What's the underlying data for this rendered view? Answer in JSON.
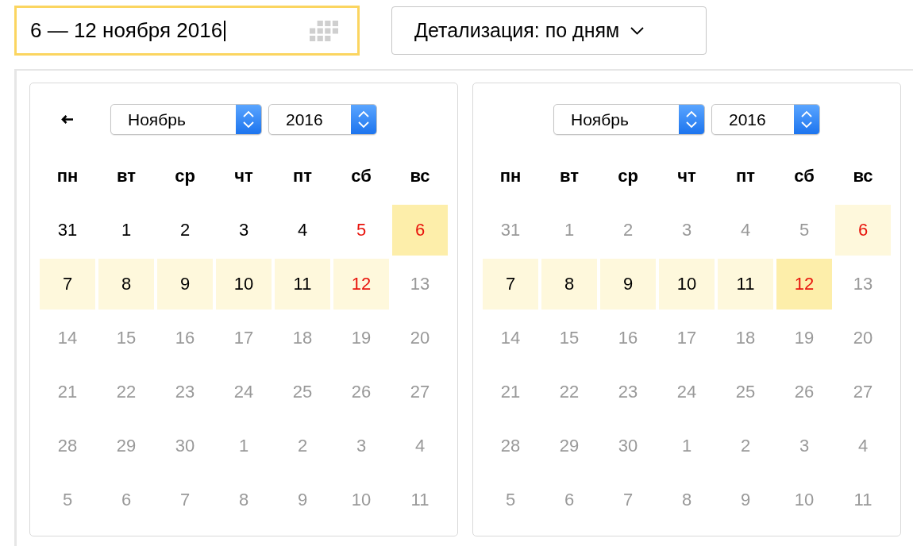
{
  "date_field": {
    "value": "6 — 12 ноября 2016",
    "focused": true
  },
  "detail_dropdown": {
    "label": "Детализация: по дням"
  },
  "calendars": [
    {
      "back_arrow": true,
      "month_select": "Ноябрь",
      "year_select": "2016",
      "weekdays": [
        "пн",
        "вт",
        "ср",
        "чт",
        "пт",
        "сб",
        "вс"
      ],
      "weeks": [
        [
          {
            "label": "31",
            "disabled": false,
            "weekend": false,
            "selected": false,
            "range_edge": false
          },
          {
            "label": "1",
            "disabled": false,
            "weekend": false,
            "selected": false,
            "range_edge": false
          },
          {
            "label": "2",
            "disabled": false,
            "weekend": false,
            "selected": false,
            "range_edge": false
          },
          {
            "label": "3",
            "disabled": false,
            "weekend": false,
            "selected": false,
            "range_edge": false
          },
          {
            "label": "4",
            "disabled": false,
            "weekend": false,
            "selected": false,
            "range_edge": false
          },
          {
            "label": "5",
            "disabled": false,
            "weekend": true,
            "selected": false,
            "range_edge": false
          },
          {
            "label": "6",
            "disabled": false,
            "weekend": true,
            "selected": true,
            "range_edge": true
          }
        ],
        [
          {
            "label": "7",
            "disabled": false,
            "weekend": false,
            "selected": true,
            "range_edge": false
          },
          {
            "label": "8",
            "disabled": false,
            "weekend": false,
            "selected": true,
            "range_edge": false
          },
          {
            "label": "9",
            "disabled": false,
            "weekend": false,
            "selected": true,
            "range_edge": false
          },
          {
            "label": "10",
            "disabled": false,
            "weekend": false,
            "selected": true,
            "range_edge": false
          },
          {
            "label": "11",
            "disabled": false,
            "weekend": false,
            "selected": true,
            "range_edge": false
          },
          {
            "label": "12",
            "disabled": false,
            "weekend": true,
            "selected": true,
            "range_edge": false
          },
          {
            "label": "13",
            "disabled": true,
            "weekend": false,
            "selected": false,
            "range_edge": false
          }
        ],
        [
          {
            "label": "14",
            "disabled": true,
            "weekend": false,
            "selected": false,
            "range_edge": false
          },
          {
            "label": "15",
            "disabled": true,
            "weekend": false,
            "selected": false,
            "range_edge": false
          },
          {
            "label": "16",
            "disabled": true,
            "weekend": false,
            "selected": false,
            "range_edge": false
          },
          {
            "label": "17",
            "disabled": true,
            "weekend": false,
            "selected": false,
            "range_edge": false
          },
          {
            "label": "18",
            "disabled": true,
            "weekend": false,
            "selected": false,
            "range_edge": false
          },
          {
            "label": "19",
            "disabled": true,
            "weekend": false,
            "selected": false,
            "range_edge": false
          },
          {
            "label": "20",
            "disabled": true,
            "weekend": false,
            "selected": false,
            "range_edge": false
          }
        ],
        [
          {
            "label": "21",
            "disabled": true,
            "weekend": false,
            "selected": false,
            "range_edge": false
          },
          {
            "label": "22",
            "disabled": true,
            "weekend": false,
            "selected": false,
            "range_edge": false
          },
          {
            "label": "23",
            "disabled": true,
            "weekend": false,
            "selected": false,
            "range_edge": false
          },
          {
            "label": "24",
            "disabled": true,
            "weekend": false,
            "selected": false,
            "range_edge": false
          },
          {
            "label": "25",
            "disabled": true,
            "weekend": false,
            "selected": false,
            "range_edge": false
          },
          {
            "label": "26",
            "disabled": true,
            "weekend": false,
            "selected": false,
            "range_edge": false
          },
          {
            "label": "27",
            "disabled": true,
            "weekend": false,
            "selected": false,
            "range_edge": false
          }
        ],
        [
          {
            "label": "28",
            "disabled": true,
            "weekend": false,
            "selected": false,
            "range_edge": false
          },
          {
            "label": "29",
            "disabled": true,
            "weekend": false,
            "selected": false,
            "range_edge": false
          },
          {
            "label": "30",
            "disabled": true,
            "weekend": false,
            "selected": false,
            "range_edge": false
          },
          {
            "label": "1",
            "disabled": true,
            "weekend": false,
            "selected": false,
            "range_edge": false
          },
          {
            "label": "2",
            "disabled": true,
            "weekend": false,
            "selected": false,
            "range_edge": false
          },
          {
            "label": "3",
            "disabled": true,
            "weekend": false,
            "selected": false,
            "range_edge": false
          },
          {
            "label": "4",
            "disabled": true,
            "weekend": false,
            "selected": false,
            "range_edge": false
          }
        ],
        [
          {
            "label": "5",
            "disabled": true,
            "weekend": false,
            "selected": false,
            "range_edge": false
          },
          {
            "label": "6",
            "disabled": true,
            "weekend": false,
            "selected": false,
            "range_edge": false
          },
          {
            "label": "7",
            "disabled": true,
            "weekend": false,
            "selected": false,
            "range_edge": false
          },
          {
            "label": "8",
            "disabled": true,
            "weekend": false,
            "selected": false,
            "range_edge": false
          },
          {
            "label": "9",
            "disabled": true,
            "weekend": false,
            "selected": false,
            "range_edge": false
          },
          {
            "label": "10",
            "disabled": true,
            "weekend": false,
            "selected": false,
            "range_edge": false
          },
          {
            "label": "11",
            "disabled": true,
            "weekend": false,
            "selected": false,
            "range_edge": false
          }
        ]
      ]
    },
    {
      "back_arrow": false,
      "month_select": "Ноябрь",
      "year_select": "2016",
      "weekdays": [
        "пн",
        "вт",
        "ср",
        "чт",
        "пт",
        "сб",
        "вс"
      ],
      "weeks": [
        [
          {
            "label": "31",
            "disabled": true,
            "weekend": false,
            "selected": false,
            "range_edge": false
          },
          {
            "label": "1",
            "disabled": true,
            "weekend": false,
            "selected": false,
            "range_edge": false
          },
          {
            "label": "2",
            "disabled": true,
            "weekend": false,
            "selected": false,
            "range_edge": false
          },
          {
            "label": "3",
            "disabled": true,
            "weekend": false,
            "selected": false,
            "range_edge": false
          },
          {
            "label": "4",
            "disabled": true,
            "weekend": false,
            "selected": false,
            "range_edge": false
          },
          {
            "label": "5",
            "disabled": true,
            "weekend": false,
            "selected": false,
            "range_edge": false
          },
          {
            "label": "6",
            "disabled": false,
            "weekend": true,
            "selected": true,
            "range_edge": false
          }
        ],
        [
          {
            "label": "7",
            "disabled": false,
            "weekend": false,
            "selected": true,
            "range_edge": false
          },
          {
            "label": "8",
            "disabled": false,
            "weekend": false,
            "selected": true,
            "range_edge": false
          },
          {
            "label": "9",
            "disabled": false,
            "weekend": false,
            "selected": true,
            "range_edge": false
          },
          {
            "label": "10",
            "disabled": false,
            "weekend": false,
            "selected": true,
            "range_edge": false
          },
          {
            "label": "11",
            "disabled": false,
            "weekend": false,
            "selected": true,
            "range_edge": false
          },
          {
            "label": "12",
            "disabled": false,
            "weekend": true,
            "selected": true,
            "range_edge": true
          },
          {
            "label": "13",
            "disabled": true,
            "weekend": false,
            "selected": false,
            "range_edge": false
          }
        ],
        [
          {
            "label": "14",
            "disabled": true,
            "weekend": false,
            "selected": false,
            "range_edge": false
          },
          {
            "label": "15",
            "disabled": true,
            "weekend": false,
            "selected": false,
            "range_edge": false
          },
          {
            "label": "16",
            "disabled": true,
            "weekend": false,
            "selected": false,
            "range_edge": false
          },
          {
            "label": "17",
            "disabled": true,
            "weekend": false,
            "selected": false,
            "range_edge": false
          },
          {
            "label": "18",
            "disabled": true,
            "weekend": false,
            "selected": false,
            "range_edge": false
          },
          {
            "label": "19",
            "disabled": true,
            "weekend": false,
            "selected": false,
            "range_edge": false
          },
          {
            "label": "20",
            "disabled": true,
            "weekend": false,
            "selected": false,
            "range_edge": false
          }
        ],
        [
          {
            "label": "21",
            "disabled": true,
            "weekend": false,
            "selected": false,
            "range_edge": false
          },
          {
            "label": "22",
            "disabled": true,
            "weekend": false,
            "selected": false,
            "range_edge": false
          },
          {
            "label": "23",
            "disabled": true,
            "weekend": false,
            "selected": false,
            "range_edge": false
          },
          {
            "label": "24",
            "disabled": true,
            "weekend": false,
            "selected": false,
            "range_edge": false
          },
          {
            "label": "25",
            "disabled": true,
            "weekend": false,
            "selected": false,
            "range_edge": false
          },
          {
            "label": "26",
            "disabled": true,
            "weekend": false,
            "selected": false,
            "range_edge": false
          },
          {
            "label": "27",
            "disabled": true,
            "weekend": false,
            "selected": false,
            "range_edge": false
          }
        ],
        [
          {
            "label": "28",
            "disabled": true,
            "weekend": false,
            "selected": false,
            "range_edge": false
          },
          {
            "label": "29",
            "disabled": true,
            "weekend": false,
            "selected": false,
            "range_edge": false
          },
          {
            "label": "30",
            "disabled": true,
            "weekend": false,
            "selected": false,
            "range_edge": false
          },
          {
            "label": "1",
            "disabled": true,
            "weekend": false,
            "selected": false,
            "range_edge": false
          },
          {
            "label": "2",
            "disabled": true,
            "weekend": false,
            "selected": false,
            "range_edge": false
          },
          {
            "label": "3",
            "disabled": true,
            "weekend": false,
            "selected": false,
            "range_edge": false
          },
          {
            "label": "4",
            "disabled": true,
            "weekend": false,
            "selected": false,
            "range_edge": false
          }
        ],
        [
          {
            "label": "5",
            "disabled": true,
            "weekend": false,
            "selected": false,
            "range_edge": false
          },
          {
            "label": "6",
            "disabled": true,
            "weekend": false,
            "selected": false,
            "range_edge": false
          },
          {
            "label": "7",
            "disabled": true,
            "weekend": false,
            "selected": false,
            "range_edge": false
          },
          {
            "label": "8",
            "disabled": true,
            "weekend": false,
            "selected": false,
            "range_edge": false
          },
          {
            "label": "9",
            "disabled": true,
            "weekend": false,
            "selected": false,
            "range_edge": false
          },
          {
            "label": "10",
            "disabled": true,
            "weekend": false,
            "selected": false,
            "range_edge": false
          },
          {
            "label": "11",
            "disabled": true,
            "weekend": false,
            "selected": false,
            "range_edge": false
          }
        ]
      ]
    }
  ]
}
